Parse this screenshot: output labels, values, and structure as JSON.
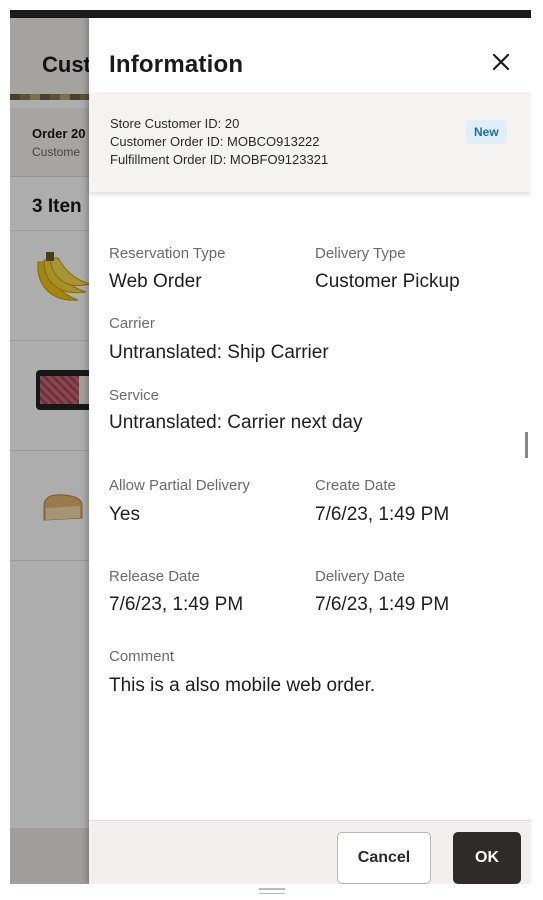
{
  "background": {
    "title_fragment": "Cust",
    "order_fragment": "Order 20",
    "customer_fragment": "Custome",
    "items_fragment": "3 Iten"
  },
  "drawer": {
    "title": "Information",
    "close_icon": "close-icon"
  },
  "summary": {
    "store_customer_id": "Store Customer ID: 20",
    "customer_order_id": "Customer Order ID: MOBCO913222",
    "fulfillment_order_id": "Fulfillment Order ID: MOBFO9123321",
    "status_badge": "New",
    "badge_color": "#dfeef7",
    "badge_text_color": "#1f6f9e"
  },
  "fields": {
    "reservation_type_label": "Reservation Type",
    "reservation_type_value": "Web Order",
    "delivery_type_label": "Delivery Type",
    "delivery_type_value": "Customer Pickup",
    "carrier_label": "Carrier",
    "carrier_value": "Untranslated: Ship Carrier",
    "service_label": "Service",
    "service_value": "Untranslated: Carrier next day",
    "allow_partial_label": "Allow Partial Delivery",
    "allow_partial_value": "Yes",
    "create_date_label": "Create Date",
    "create_date_value": "7/6/23, 1:49 PM",
    "release_date_label": "Release Date",
    "release_date_value": "7/6/23, 1:49 PM",
    "delivery_date_label": "Delivery Date",
    "delivery_date_value": "7/6/23, 1:49 PM",
    "comment_label": "Comment",
    "comment_value": "This is a also mobile web order."
  },
  "footer": {
    "cancel_label": "Cancel",
    "ok_label": "OK",
    "primary_color": "#2e2b28"
  }
}
